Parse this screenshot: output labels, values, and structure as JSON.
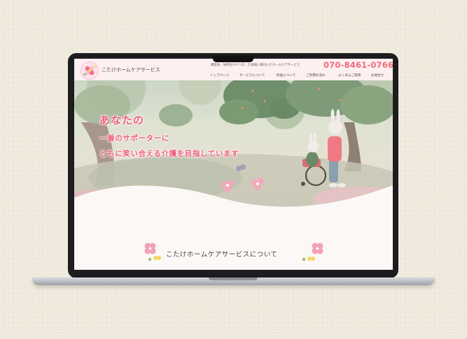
{
  "site": {
    "name": "こたけホームケアサービス",
    "tagline": "講習会、研修生ホヤリの、た地域に根付いたホームケアサービス",
    "phone": "070-8461-0766"
  },
  "nav": [
    {
      "label": "トップページ"
    },
    {
      "label": "サービスについて"
    },
    {
      "label": "料金について"
    },
    {
      "label": "ご利用の流れ"
    },
    {
      "label": "よくあるご質問"
    },
    {
      "label": "お問合せ"
    }
  ],
  "hero": {
    "line1": "あなたの",
    "line2": "一番のサポーターに",
    "line3": "ともに笑い合える介護を目指しています"
  },
  "about": {
    "title": "こたけホームケアサービスについて"
  },
  "colors": {
    "accent": "#ee6b78",
    "header_bg": "#fdf0f0",
    "page_bg": "#efe9dc"
  }
}
